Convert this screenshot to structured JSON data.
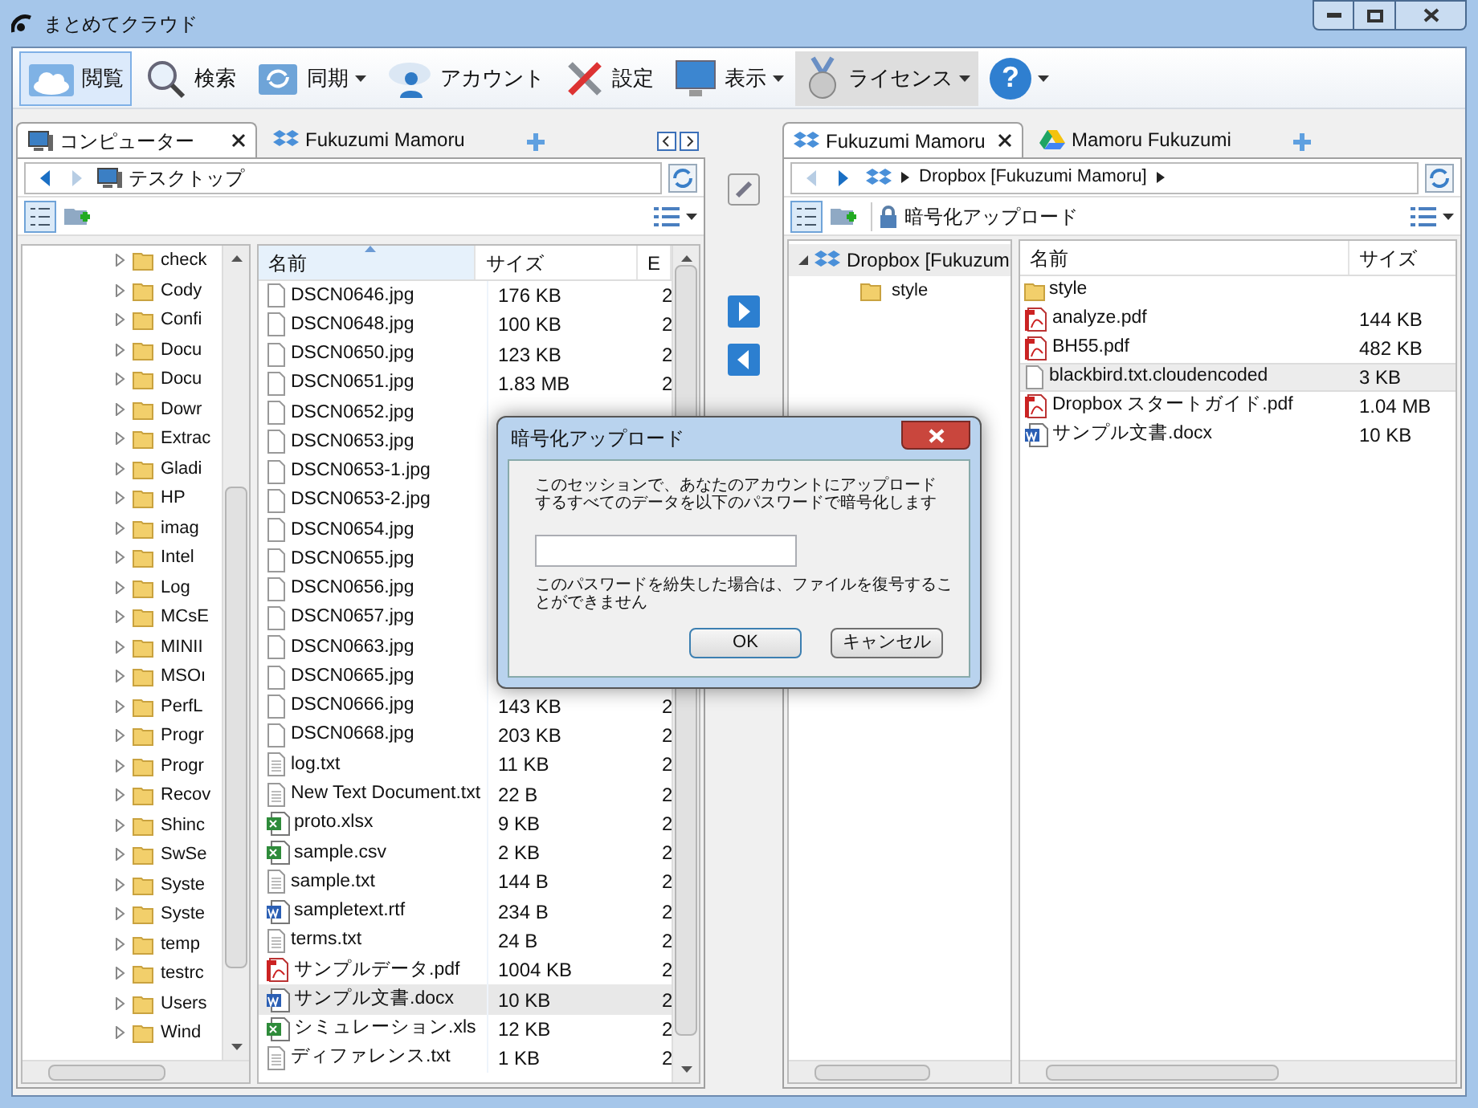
{
  "window": {
    "title": "まとめてクラウド"
  },
  "toolbar": [
    {
      "label": "閲覧",
      "selected": true,
      "hovered": false,
      "dropdown": false
    },
    {
      "label": "検索",
      "selected": false,
      "hovered": false,
      "dropdown": false
    },
    {
      "label": "同期",
      "selected": false,
      "hovered": false,
      "dropdown": true
    },
    {
      "label": "アカウント",
      "selected": false,
      "hovered": false,
      "dropdown": false
    },
    {
      "label": "設定",
      "selected": false,
      "hovered": false,
      "dropdown": false
    },
    {
      "label": "表示",
      "selected": false,
      "hovered": false,
      "dropdown": true
    },
    {
      "label": "ライセンス",
      "selected": false,
      "hovered": true,
      "dropdown": true
    },
    {
      "label": "?",
      "selected": false,
      "hovered": false,
      "dropdown": true
    }
  ],
  "left_pane": {
    "tabs": [
      {
        "label": "コンピューター",
        "selected": true
      },
      {
        "label": "Fukuzumi Mamoru",
        "selected": false
      }
    ],
    "address": "テスクトップ",
    "tree": [
      "check",
      "Cody",
      "Confi",
      "Docu",
      "Docu",
      "Dowr",
      "Extrac",
      "Gladi",
      "HP",
      "imag",
      "Intel",
      "Log",
      "MCsE",
      "MINII",
      "MSOı",
      "PerfL",
      "Progr",
      "Progr",
      "Recov",
      "Shinc",
      "SwSe",
      "Syste",
      "Syste",
      "temp",
      "testrc",
      "Users",
      "Wind"
    ],
    "columns": [
      "名前",
      "サイズ",
      "E"
    ],
    "files": [
      {
        "name": "DSCN0646.jpg",
        "kind": "file",
        "size": "176 KB",
        "column_3": "2",
        "selected": false
      },
      {
        "name": "DSCN0648.jpg",
        "kind": "file",
        "size": "100 KB",
        "column_3": "2",
        "selected": false
      },
      {
        "name": "DSCN0650.jpg",
        "kind": "file",
        "size": "123 KB",
        "column_3": "2",
        "selected": false
      },
      {
        "name": "DSCN0651.jpg",
        "kind": "file",
        "size": "1.83 MB",
        "column_3": "2",
        "selected": false
      },
      {
        "name": "DSCN0652.jpg",
        "kind": "file",
        "selected": false
      },
      {
        "name": "DSCN0653.jpg",
        "kind": "file",
        "selected": false
      },
      {
        "name": "DSCN0653-1.jpg",
        "kind": "file",
        "selected": false
      },
      {
        "name": "DSCN0653-2.jpg",
        "kind": "file",
        "selected": false
      },
      {
        "name": "DSCN0654.jpg",
        "kind": "file",
        "selected": false
      },
      {
        "name": "DSCN0655.jpg",
        "kind": "file",
        "selected": false
      },
      {
        "name": "DSCN0656.jpg",
        "kind": "file",
        "selected": false
      },
      {
        "name": "DSCN0657.jpg",
        "kind": "file",
        "selected": false
      },
      {
        "name": "DSCN0663.jpg",
        "kind": "file",
        "selected": false
      },
      {
        "name": "DSCN0665.jpg",
        "kind": "file",
        "selected": false
      },
      {
        "name": "DSCN0666.jpg",
        "kind": "file",
        "size": "143 KB",
        "column_3": "2",
        "selected": false
      },
      {
        "name": "DSCN0668.jpg",
        "kind": "file",
        "size": "203 KB",
        "column_3": "2",
        "selected": false
      },
      {
        "name": "log.txt",
        "kind": "text",
        "size": "11 KB",
        "column_3": "2",
        "selected": false
      },
      {
        "name": "New Text Document.txt",
        "kind": "text",
        "size": "22 B",
        "column_3": "2",
        "selected": false
      },
      {
        "name": "proto.xlsx",
        "kind": "excel",
        "size": "9 KB",
        "column_3": "2",
        "selected": false
      },
      {
        "name": "sample.csv",
        "kind": "excel",
        "size": "2 KB",
        "column_3": "2",
        "selected": false
      },
      {
        "name": "sample.txt",
        "kind": "text",
        "size": "144 B",
        "column_3": "2",
        "selected": false
      },
      {
        "name": "sampletext.rtf",
        "kind": "word",
        "size": "234 B",
        "column_3": "2",
        "selected": false
      },
      {
        "name": "terms.txt",
        "kind": "text",
        "size": "24 B",
        "column_3": "2",
        "selected": false
      },
      {
        "name": "サンプルデータ.pdf",
        "kind": "pdf",
        "size": "1004 KB",
        "column_3": "2",
        "selected": false
      },
      {
        "name": "サンプル文書.docx",
        "kind": "word",
        "size": "10 KB",
        "column_3": "2",
        "selected": true
      },
      {
        "name": "シミュレーション.xls",
        "kind": "excel",
        "size": "12 KB",
        "column_3": "2",
        "selected": false
      },
      {
        "name": "ディファレンス.txt",
        "kind": "text",
        "size": "1 KB",
        "column_3": "2",
        "selected": false
      }
    ]
  },
  "right_pane": {
    "tabs": [
      {
        "label": "Fukuzumi Mamoru",
        "selected": true
      },
      {
        "label": "Mamoru Fukuzumi",
        "selected": false
      }
    ],
    "breadcrumb": "Dropbox [Fukuzumi Mamoru]",
    "encrypt_button": "暗号化アップロード",
    "tree": [
      {
        "label": "Dropbox [Fukuzum",
        "selected": true,
        "expanded": true,
        "children": [
          {
            "label": "style",
            "selected": false
          }
        ]
      }
    ],
    "columns": [
      "名前",
      "サイズ"
    ],
    "files": [
      {
        "name": "style",
        "kind": "folder",
        "selected": false
      },
      {
        "name": "analyze.pdf",
        "kind": "pdf",
        "size": "144 KB",
        "selected": false
      },
      {
        "name": "BH55.pdf",
        "kind": "pdf",
        "size": "482 KB",
        "selected": false
      },
      {
        "name": "blackbird.txt.cloudencoded",
        "kind": "file",
        "size": "3 KB",
        "selected": true
      },
      {
        "name": "Dropbox スタートガイド.pdf",
        "kind": "pdf",
        "size": "1.04 MB",
        "selected": false
      },
      {
        "name": "サンプル文書.docx",
        "kind": "word",
        "size": "10 KB",
        "selected": false
      }
    ]
  },
  "dialog": {
    "title": "暗号化アップロード",
    "message": "このセッションで、あなたのアカウントにアップロードするすべてのデータを以下のパスワードで暗号化します",
    "warning": "このパスワードを紛失した場合は、ファイルを復号することができません",
    "buttons": [
      "OK",
      "キャンセル"
    ]
  }
}
